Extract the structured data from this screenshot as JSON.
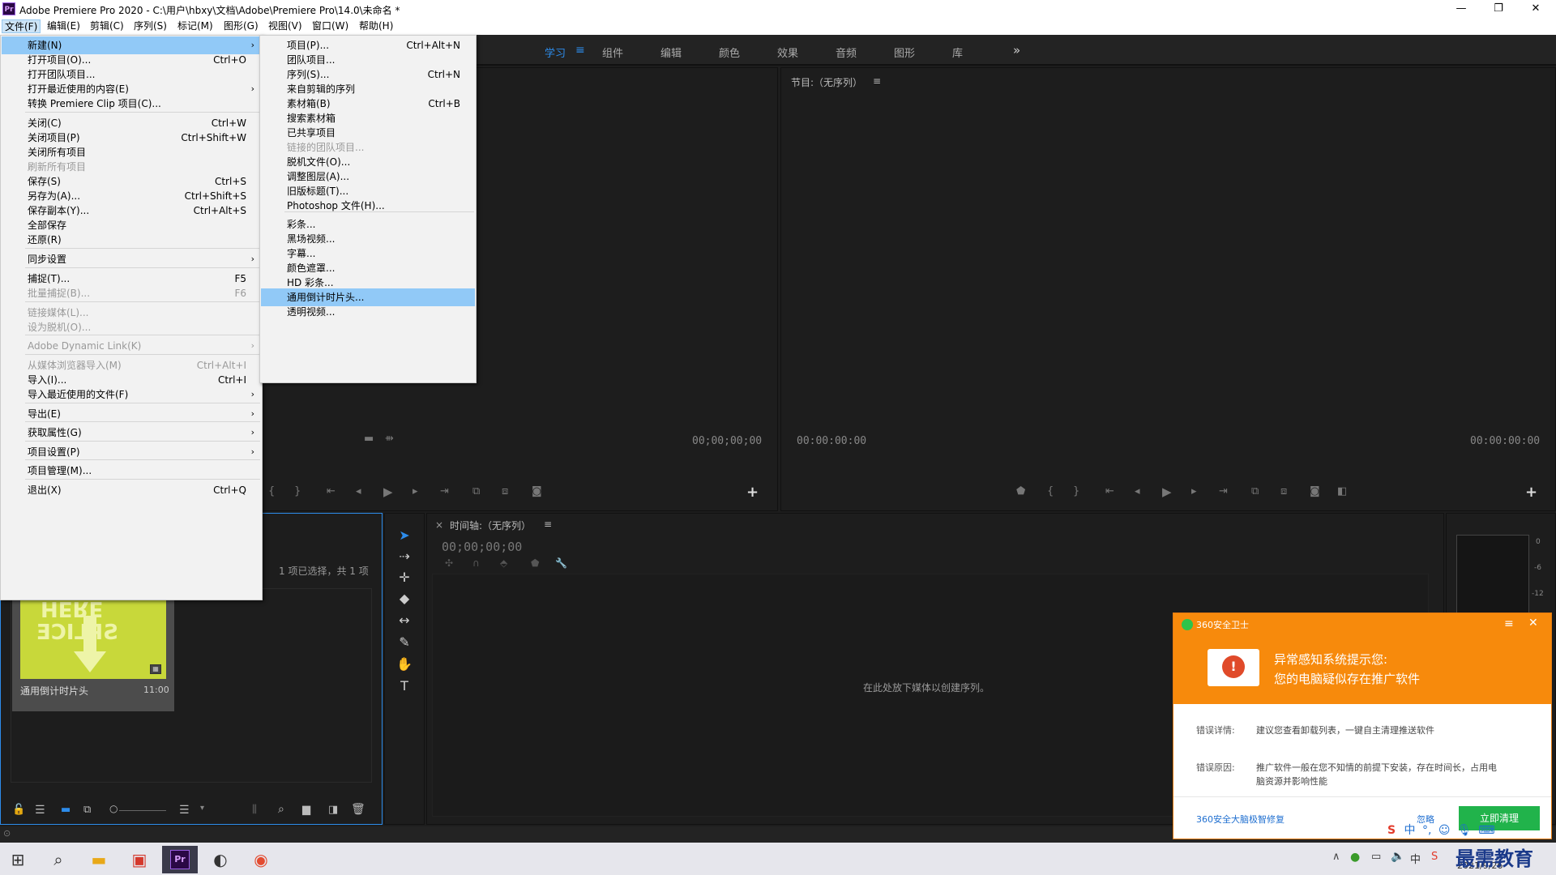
{
  "window": {
    "app_icon": "Pr",
    "title": "Adobe Premiere Pro 2020 - C:\\用户\\hbxy\\文档\\Adobe\\Premiere Pro\\14.0\\未命名 *",
    "minimize": "—",
    "restore": "❐",
    "close": "✕"
  },
  "menubar": [
    "文件(F)",
    "编辑(E)",
    "剪辑(C)",
    "序列(S)",
    "标记(M)",
    "图形(G)",
    "视图(V)",
    "窗口(W)",
    "帮助(H)"
  ],
  "workspaces": [
    "学习",
    "组件",
    "编辑",
    "颜色",
    "效果",
    "音频",
    "图形",
    "库"
  ],
  "workspace_menu_icon": "≡",
  "workspace_more": "»",
  "source_monitor": {
    "timecode": "00;00;00;00"
  },
  "program_monitor": {
    "title": "节目:（无序列）",
    "menu": "≡",
    "timecode_left": "00:00:00:00",
    "timecode_right": "00:00:00:00"
  },
  "project_panel": {
    "selection_info": "1 项已选择，共 1 项",
    "clip_name": "通用倒计时片头",
    "clip_duration": "11:00",
    "thumb_text_top": "HERE",
    "thumb_text_bottom": "SPLICE"
  },
  "timeline": {
    "close": "×",
    "title": "时间轴:（无序列）",
    "menu": "≡",
    "timecode": "00;00;00;00",
    "empty_message": "在此处放下媒体以创建序列。"
  },
  "audio_meter": {
    "labels": [
      "0",
      "-6",
      "-12"
    ]
  },
  "file_menu": {
    "items": [
      {
        "label": "新建(N)",
        "shortcut": "",
        "submenu": true,
        "highlight": true,
        "disabled": false
      },
      {
        "label": "打开项目(O)...",
        "shortcut": "Ctrl+O",
        "submenu": false,
        "disabled": false
      },
      {
        "label": "打开团队项目...",
        "shortcut": "",
        "submenu": false,
        "disabled": false
      },
      {
        "label": "打开最近使用的内容(E)",
        "shortcut": "",
        "submenu": true,
        "disabled": false
      },
      {
        "label": "转换 Premiere Clip 项目(C)...",
        "shortcut": "",
        "submenu": false,
        "disabled": false
      },
      {
        "label": "关闭(C)",
        "shortcut": "Ctrl+W",
        "submenu": false,
        "disabled": false
      },
      {
        "label": "关闭项目(P)",
        "shortcut": "Ctrl+Shift+W",
        "submenu": false,
        "disabled": false
      },
      {
        "label": "关闭所有项目",
        "shortcut": "",
        "submenu": false,
        "disabled": false
      },
      {
        "label": "刷新所有项目",
        "shortcut": "",
        "submenu": false,
        "disabled": true
      },
      {
        "label": "保存(S)",
        "shortcut": "Ctrl+S",
        "submenu": false,
        "disabled": false
      },
      {
        "label": "另存为(A)...",
        "shortcut": "Ctrl+Shift+S",
        "submenu": false,
        "disabled": false
      },
      {
        "label": "保存副本(Y)...",
        "shortcut": "Ctrl+Alt+S",
        "submenu": false,
        "disabled": false
      },
      {
        "label": "全部保存",
        "shortcut": "",
        "submenu": false,
        "disabled": false
      },
      {
        "label": "还原(R)",
        "shortcut": "",
        "submenu": false,
        "disabled": false
      },
      {
        "label": "同步设置",
        "shortcut": "",
        "submenu": true,
        "disabled": false
      },
      {
        "label": "捕捉(T)...",
        "shortcut": "F5",
        "submenu": false,
        "disabled": false
      },
      {
        "label": "批量捕捉(B)...",
        "shortcut": "F6",
        "submenu": false,
        "disabled": true
      },
      {
        "label": "链接媒体(L)...",
        "shortcut": "",
        "submenu": false,
        "disabled": true
      },
      {
        "label": "设为脱机(O)...",
        "shortcut": "",
        "submenu": false,
        "disabled": true
      },
      {
        "label": "Adobe Dynamic Link(K)",
        "shortcut": "",
        "submenu": true,
        "disabled": true
      },
      {
        "label": "从媒体浏览器导入(M)",
        "shortcut": "Ctrl+Alt+I",
        "submenu": false,
        "disabled": true
      },
      {
        "label": "导入(I)...",
        "shortcut": "Ctrl+I",
        "submenu": false,
        "disabled": false
      },
      {
        "label": "导入最近使用的文件(F)",
        "shortcut": "",
        "submenu": true,
        "disabled": false
      },
      {
        "label": "导出(E)",
        "shortcut": "",
        "submenu": true,
        "disabled": false
      },
      {
        "label": "获取属性(G)",
        "shortcut": "",
        "submenu": true,
        "disabled": false
      },
      {
        "label": "项目设置(P)",
        "shortcut": "",
        "submenu": true,
        "disabled": false
      },
      {
        "label": "项目管理(M)...",
        "shortcut": "",
        "submenu": false,
        "disabled": false
      },
      {
        "label": "退出(X)",
        "shortcut": "Ctrl+Q",
        "submenu": false,
        "disabled": false
      }
    ]
  },
  "new_submenu": {
    "items": [
      {
        "label": "项目(P)...",
        "shortcut": "Ctrl+Alt+N",
        "disabled": false
      },
      {
        "label": "团队项目...",
        "shortcut": "",
        "disabled": false
      },
      {
        "label": "序列(S)...",
        "shortcut": "Ctrl+N",
        "disabled": false
      },
      {
        "label": "来自剪辑的序列",
        "shortcut": "",
        "disabled": false
      },
      {
        "label": "素材箱(B)",
        "shortcut": "Ctrl+B",
        "disabled": false
      },
      {
        "label": "搜索素材箱",
        "shortcut": "",
        "disabled": false
      },
      {
        "label": "已共享项目",
        "shortcut": "",
        "disabled": false
      },
      {
        "label": "链接的团队项目...",
        "shortcut": "",
        "disabled": true
      },
      {
        "label": "脱机文件(O)...",
        "shortcut": "",
        "disabled": false
      },
      {
        "label": "调整图层(A)...",
        "shortcut": "",
        "disabled": false
      },
      {
        "label": "旧版标题(T)...",
        "shortcut": "",
        "disabled": false
      },
      {
        "label": "Photoshop 文件(H)...",
        "shortcut": "",
        "disabled": false
      },
      {
        "label": "彩条...",
        "shortcut": "",
        "disabled": false
      },
      {
        "label": "黑场视频...",
        "shortcut": "",
        "disabled": false
      },
      {
        "label": "字幕...",
        "shortcut": "",
        "disabled": false
      },
      {
        "label": "颜色遮罩...",
        "shortcut": "",
        "disabled": false
      },
      {
        "label": "HD 彩条...",
        "shortcut": "",
        "disabled": false
      },
      {
        "label": "通用倒计时片头...",
        "shortcut": "",
        "disabled": false,
        "highlight": true
      },
      {
        "label": "透明视频...",
        "shortcut": "",
        "disabled": false
      }
    ]
  },
  "popup_360": {
    "brand": "360安全卫士",
    "heading1": "异常感知系统提示您:",
    "heading2": "您的电脑疑似存在推广软件",
    "detail_label": "错误详情:",
    "detail_text": "建议您查看卸载列表，一键自主清理推送软件",
    "reason_label": "错误原因:",
    "reason_text1": "推广软件一般在您不知情的前提下安装，存在时间长，占用电",
    "reason_text2": "脑资源并影响性能",
    "link": "360安全大脑极智修复",
    "ignore": "忽略",
    "action": "立即清理",
    "accent": "#f78a0c",
    "button_color": "#21b34b"
  },
  "taskbar": {
    "ime": "中",
    "date": "2021/9/26",
    "watermark": "最需教育"
  }
}
